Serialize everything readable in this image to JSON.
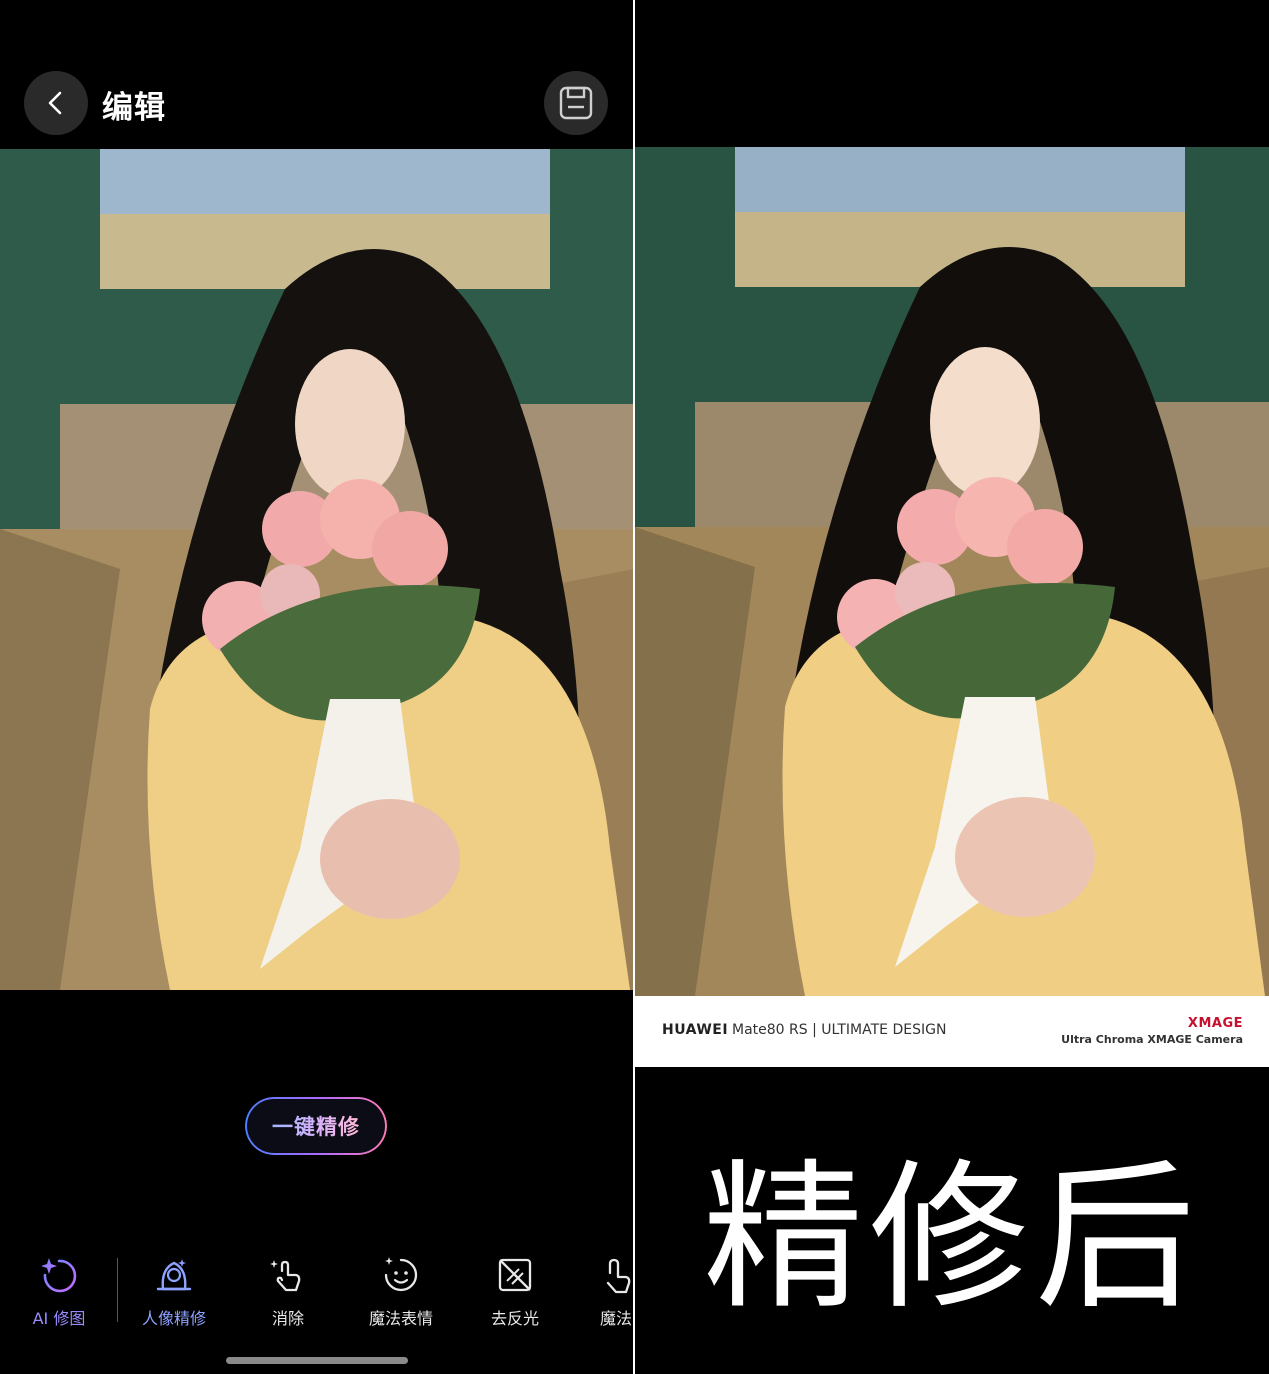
{
  "header": {
    "title": "编辑"
  },
  "actions": {
    "one_tap_label": "一键精修"
  },
  "toolbar": {
    "items": [
      {
        "label": "AI 修图",
        "icon": "ai-retouch-icon"
      },
      {
        "label": "人像精修",
        "icon": "portrait-retouch-icon",
        "active": true
      },
      {
        "label": "消除",
        "icon": "erase-icon"
      },
      {
        "label": "魔法表情",
        "icon": "magic-expression-icon"
      },
      {
        "label": "去反光",
        "icon": "remove-reflection-icon"
      },
      {
        "label": "魔法",
        "icon": "magic-hand-icon"
      }
    ]
  },
  "watermark": {
    "brand": "HUAWEI",
    "model": "Mate80 RS | ULTIMATE DESIGN",
    "xmage": "XMAGE",
    "camera": "Ultra Chroma XMAGE Camera"
  },
  "caption": "精修后",
  "colors": {
    "accent": "#8ea2ff",
    "gradient_start": "#4f7dff",
    "gradient_end": "#ff7bb4",
    "brand_red": "#c8102e"
  }
}
